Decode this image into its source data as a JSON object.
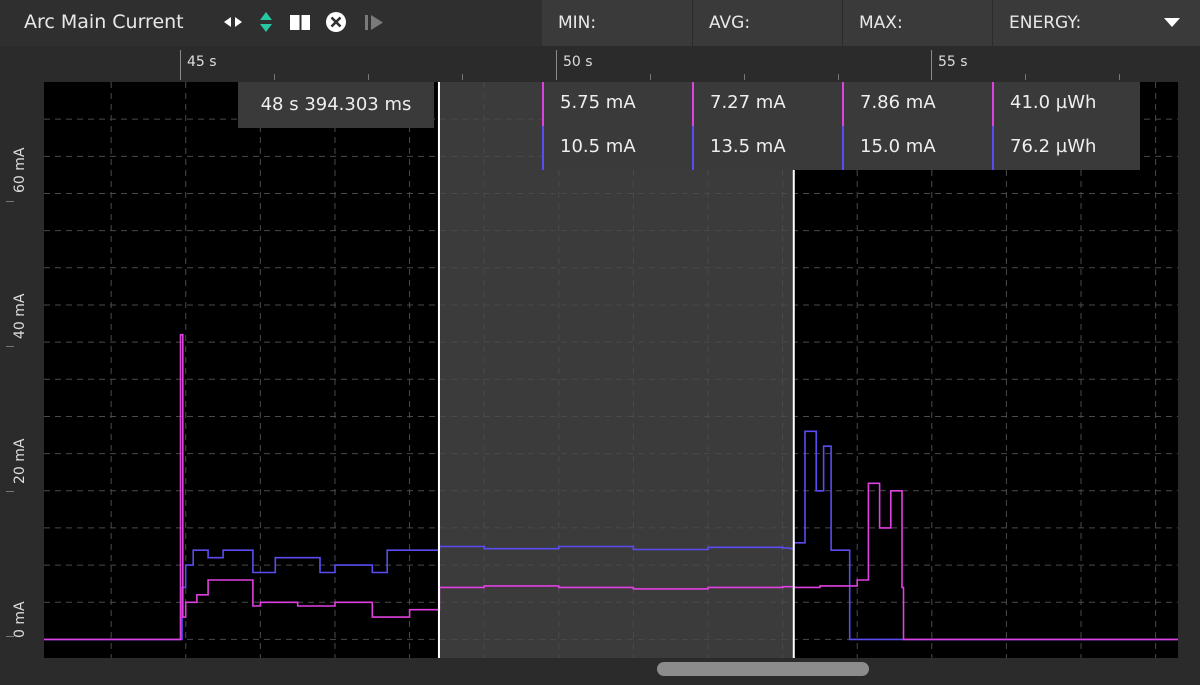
{
  "header": {
    "title": "Arc Main Current",
    "tools": [
      "pan-horizontal-icon",
      "zoom-vertical-icon",
      "pause-icon",
      "clear-icon",
      "play-next-icon"
    ],
    "stat_columns": [
      "MIN:",
      "AVG:",
      "MAX:",
      "ENERGY:"
    ],
    "menu_icon": "chevron-down-icon"
  },
  "cursor": {
    "label": "48 s 394.303 ms",
    "time_s": 48.394
  },
  "selection": {
    "start_s": 48.394,
    "end_s": 53.15
  },
  "stats": [
    {
      "color": "#e040e0",
      "min": "5.75 mA",
      "avg": "7.27 mA",
      "max": "7.86 mA",
      "energy": "41.0 µWh"
    },
    {
      "color": "#5a4cf0",
      "min": "10.5 mA",
      "avg": "13.5 mA",
      "max": "15.0 mA",
      "energy": "76.2 µWh"
    }
  ],
  "chart_data": {
    "type": "line",
    "x_ticks": [
      "45 s",
      "50 s",
      "55 s"
    ],
    "x_tick_values": [
      45,
      50,
      55
    ],
    "y_ticks": [
      "0 mA",
      "20 mA",
      "40 mA",
      "60 mA"
    ],
    "y_tick_values": [
      0,
      20,
      40,
      60
    ],
    "xlim": [
      43.1,
      58.3
    ],
    "ylim": [
      -2.5,
      75
    ],
    "grid": true,
    "series": [
      {
        "color": "#5a4cf0",
        "x": [
          43.1,
          44.9,
          44.95,
          45.0,
          45.1,
          45.3,
          45.5,
          45.9,
          46.2,
          46.8,
          47.0,
          47.5,
          47.7,
          48.0,
          48.4,
          49.0,
          50.0,
          51.0,
          52.0,
          53.0,
          53.1,
          53.15,
          53.3,
          53.45,
          53.55,
          53.65,
          53.8,
          53.9,
          54.6,
          58.3
        ],
        "y": [
          0,
          0,
          7,
          10,
          12,
          11,
          12,
          9,
          11,
          9,
          10,
          9,
          12,
          12,
          12.5,
          12.2,
          12.5,
          12.1,
          12.4,
          12.3,
          12.2,
          13,
          28,
          20,
          26,
          12,
          12,
          0,
          0,
          0
        ]
      },
      {
        "color": "#e040e0",
        "x": [
          43.1,
          44.9,
          44.93,
          44.96,
          45.0,
          45.15,
          45.3,
          45.5,
          45.9,
          46.0,
          46.5,
          47.0,
          47.5,
          48.0,
          48.4,
          49.0,
          50.0,
          51.0,
          52.0,
          53.0,
          53.15,
          53.5,
          54.0,
          54.15,
          54.3,
          54.45,
          54.6,
          54.62,
          58.3
        ],
        "y": [
          0,
          0,
          41,
          3,
          5,
          6,
          8,
          8,
          4.5,
          5,
          4.5,
          5,
          3,
          4,
          7,
          7.2,
          7,
          6.8,
          7,
          7.1,
          7,
          7.2,
          8,
          21,
          15,
          20,
          7,
          0,
          0
        ]
      }
    ]
  }
}
